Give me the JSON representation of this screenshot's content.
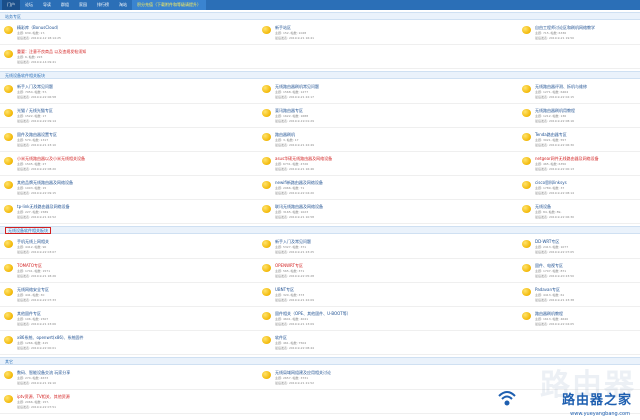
{
  "nav": [
    "门户",
    "论坛",
    "导读",
    "群组",
    "家园",
    "排行榜",
    "淘站",
    "积分充值（下载附件和等级请提升）"
  ],
  "sections": [
    {
      "title": "站务专区",
      "rows": [
        [
          {
            "name": "精彩库（BonusCloud）",
            "stat": "主题: 639, 帖数: 17,",
            "post": "最后发表: 2019-9-12 18:14:25",
            "red": false
          },
          {
            "name": "新手站区",
            "stat": "主题: 152, 帖数: 1028",
            "post": "最后发表: 2019-9-21 16:41",
            "red": false
          },
          {
            "name": "自由工程师讨论区和刷机网络教学",
            "stat": "主题: 715, 帖数: 6336",
            "post": "最后发表: 2019-9-21 19:50",
            "red": false
          }
        ],
        [
          {
            "name": "重要：注意不良商品 以及违规发帖须知",
            "stat": "主题: 6, 帖数: 223",
            "post": "最后发表: 2019-9-14 09:41",
            "red": true
          },
          null,
          null
        ]
      ]
    },
    {
      "title": "无线设备软件相关板块",
      "rows": [
        [
          {
            "name": "新手入门及常见问题",
            "stat": "主题: 7954, 帖数: 57,",
            "post": "最后发表: 2019-9-22 06:58",
            "red": false
          },
          {
            "name": "无线路由器刷机常见问题",
            "stat": "主题: 1568, 帖数: 1277",
            "post": "最后发表: 2019-9-21 22:17",
            "red": false
          },
          {
            "name": "无线路由器评测、拆机与维修",
            "stat": "主题: 1271, 帖数: 6464",
            "post": "最后发表: 2019-9-22 02:15",
            "red": false
          }
        ],
        [
          {
            "name": "光猫 / 无线光猫专区",
            "stat": "主题: 1522, 帖数: 17",
            "post": "最后发表: 2019-9-22 09:14",
            "red": false
          },
          {
            "name": "斐讯路由器专区",
            "stat": "主题: 1622, 帖数: 1688",
            "post": "最后发表: 2019-9-19 01:29",
            "red": false
          },
          {
            "name": "无线路由器刷机用教程",
            "stat": "主题: 1212, 帖数: 136",
            "post": "最后发表: 2019-9-22 08:16",
            "red": false
          }
        ],
        [
          {
            "name": "固件及路由器设置专区",
            "stat": "主题: 570, 帖数: 1317",
            "post": "最后发表: 2019-9-21 23:10",
            "red": false
          },
          {
            "name": "路由器刷机",
            "stat": "主题: 3, 帖数: 17",
            "post": "最后发表: 2019-9-21 22:49",
            "red": false
          },
          {
            "name": "Tenda路由器专区",
            "stat": "主题: 3021, 帖数: 557",
            "post": "最后发表: 2019-9-22 06:30",
            "red": false
          }
        ],
        [
          {
            "name": "小米无线路由器以及小米无线相关设备",
            "stat": "主题: 1545, 帖数: 27",
            "post": "最后发表: 2019-9-22 08:20",
            "red": true
          },
          {
            "name": "asus华硕无线路由器及网络设备",
            "stat": "主题: 6731, 帖数: 4726",
            "post": "最后发表: 2019-9-21 16:46",
            "red": true
          },
          {
            "name": "netgear网件无线路由器及网络设备",
            "stat": "主题: 465, 帖数: 6350",
            "post": "最后发表: 2019-9-22 00:13",
            "red": true
          }
        ],
        [
          {
            "name": "其他品牌无线路由器及网络设备",
            "stat": "主题: 1003, 帖数: 15",
            "post": "最后发表: 2019-9-22 09:15",
            "red": false
          },
          {
            "name": "newifi新路由器及网络设备",
            "stat": "主题: 2966, 帖数: 71",
            "post": "最后发表: 2019-9-22 04:20",
            "red": false
          },
          {
            "name": "cisco思科linksys",
            "stat": "主题: 1789, 帖数: 37",
            "post": "最后发表: 2019-9-22 08:14",
            "red": false
          }
        ],
        [
          {
            "name": "tp-link无线路由器及网络设备",
            "stat": "主题: 227, 帖数: 1589",
            "post": "最后发表: 2019-9-21 22:52",
            "red": false
          },
          {
            "name": "联讯无线路由器及网络设备",
            "stat": "主题: 3165, 帖数: 1023",
            "post": "最后发表: 2019-9-21 10:58",
            "red": false
          },
          {
            "name": "无线设备",
            "stat": "主题: 84, 帖数: 89,",
            "post": "最后发表: 2019-9-22 06:30",
            "red": false
          }
        ]
      ]
    },
    {
      "title": "无线设备软件相关板块",
      "boxed": true,
      "rows": [
        [
          {
            "name": "手机无线上网相关",
            "stat": "主题: 4412, 帖数: 90",
            "post": "最后发表: 2019-9-22 03:07",
            "red": false
          },
          {
            "name": "新手入门及常见问题",
            "stat": "主题: 5327, 帖数: 371",
            "post": "最后发表: 2019-9-21 23:25",
            "red": false
          },
          {
            "name": "DD-WRT专区",
            "stat": "主题: 2413, 帖数: 1077",
            "post": "最后发表: 2019-9-22 07:05",
            "red": false
          }
        ],
        [
          {
            "name": "TOMATO专区",
            "stat": "主题: 1741, 帖数: 1571",
            "post": "最后发表: 2019-9-21 18:26",
            "red": true
          },
          {
            "name": "OPENWRT专区",
            "stat": "主题: 565, 帖数: 371",
            "post": "最后发表: 2019-9-22 05:28",
            "red": true
          },
          {
            "name": "固件、电视专区",
            "stat": "主题: 1707, 帖数: 871",
            "post": "最后发表: 2019-9-20 23:50",
            "red": false
          }
        ],
        [
          {
            "name": "无线网络安全专区",
            "stat": "主题: 441, 帖数: 30",
            "post": "最后发表: 2019-9-22 07:33",
            "red": false
          },
          {
            "name": "UBNT专区",
            "stat": "主题: 320, 帖数: 373",
            "post": "最后发表: 2019-9-21 22:09",
            "red": false
          },
          {
            "name": "Padavan专区",
            "stat": "主题: 4413, 帖数: 61",
            "post": "最后发表: 2019-9-21 23:38",
            "red": false
          }
        ],
        [
          {
            "name": "其他固件专区",
            "stat": "主题: 106, 帖数: 1507",
            "post": "最后发表: 2019-9-21 23:06",
            "red": false
          },
          {
            "name": "固件相关（OPE、其他固件、U-BOOT等）",
            "stat": "主题: 4641, 帖数: 4041",
            "post": "最后发表: 2019-9-21 13:09",
            "red": false
          },
          {
            "name": "路由器刷机教程",
            "stat": "主题: 1613, 帖数: 4640",
            "post": "最后发表: 2019-9-22 04:05",
            "red": false
          }
        ],
        [
          {
            "name": "x86系统、openwrt(x86)、系统固件",
            "stat": "主题: 1266, 帖数: 415",
            "post": "最后发表: 2019-9-22 00:01",
            "red": false
          },
          {
            "name": "软件区",
            "stat": "主题: 461, 帖数: 7504",
            "post": "最后发表: 2019-9-22 08:44",
            "red": false
          },
          null
        ]
      ]
    },
    {
      "title": "其它",
      "rows": [
        [
          {
            "name": "数码、智能设备交流 玩家分享",
            "stat": "主题: 274, 帖数: 4673",
            "post": "最后发表: 2019-9-21 19:10",
            "red": false
          },
          {
            "name": "无线局域网组建及应用相关讨论",
            "stat": "主题: 2657, 帖数: 3731",
            "post": "最后发表: 2019-9-21 21:52",
            "red": false
          },
          null
        ],
        [
          {
            "name": "iptv资源、TV相关、其他资源",
            "stat": "主题: 2066, 帖数: 157,",
            "post": "最后发表: 2019-9-22 07:51",
            "red": true
          },
          null,
          null
        ]
      ]
    }
  ],
  "watermark": {
    "faint": "路由器",
    "title": "路由器之家",
    "url": "www.yueyangbang.com"
  }
}
